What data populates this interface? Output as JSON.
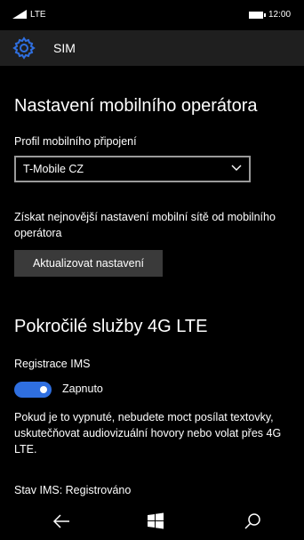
{
  "status_bar": {
    "carrier": "LTE",
    "time": "12:00",
    "icons": [
      "signal-icon",
      "battery-icon"
    ]
  },
  "header": {
    "icon": "gear-icon",
    "title": "SIM",
    "accent_color": "#2f6fe0"
  },
  "section_operator": {
    "title": "Nastavení mobilního operátora",
    "profile_label": "Profil mobilního připojení",
    "profile_selected": "T-Mobile CZ",
    "update_description": "Získat nejnovější nastavení mobilní sítě od mobilního operátora",
    "update_button": "Aktualizovat nastavení"
  },
  "section_lte": {
    "title": "Pokročilé služby 4G LTE",
    "ims_label": "Registrace IMS",
    "ims_toggle_state": "Zapnuto",
    "ims_toggle_on": true,
    "warning_text": "Pokud je to vypnuté, nebudete moct posílat textovky, uskutečňovat audiovizuální hovory nebo volat přes 4G LTE.",
    "ims_status": "Stav IMS: Registrováno"
  },
  "nav_bar": {
    "icons": [
      "back-arrow-icon",
      "windows-start-icon",
      "search-icon"
    ]
  }
}
